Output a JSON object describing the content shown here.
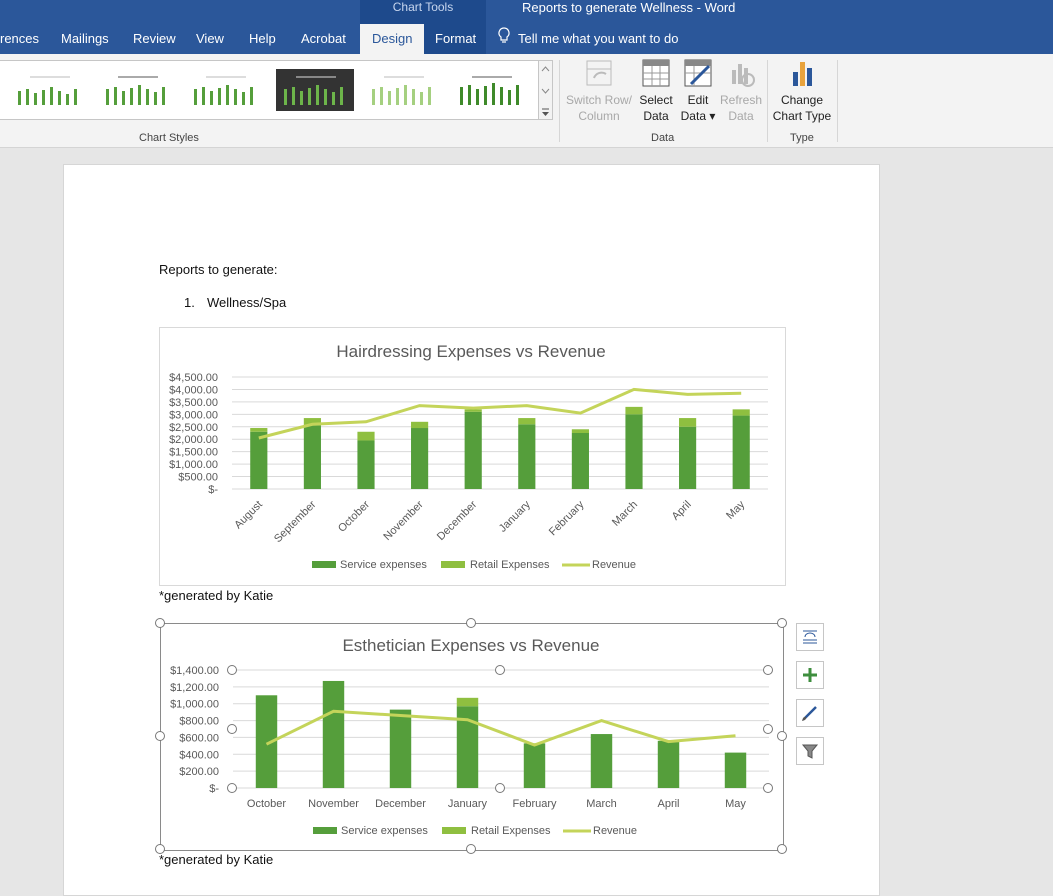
{
  "window": {
    "contextual_tab_group": "Chart Tools",
    "doc_title": "Reports to generate Wellness  -  Word"
  },
  "tabs": [
    "rences",
    "Mailings",
    "Review",
    "View",
    "Help",
    "Acrobat",
    "Design",
    "Format"
  ],
  "active_tab": "Design",
  "tellme": "Tell me what you want to do",
  "ribbon": {
    "chart_styles_label": "Chart Styles",
    "data_label": "Data",
    "type_label": "Type",
    "switch_row_1": "Switch Row/",
    "switch_row_2": "Column",
    "select_data_1": "Select",
    "select_data_2": "Data",
    "edit_data_1": "Edit",
    "edit_data_2": "Data ▾",
    "refresh_1": "Refresh",
    "refresh_2": "Data",
    "change_type_1": "Change",
    "change_type_2": "Chart Type"
  },
  "document": {
    "heading": "Reports to generate:",
    "list_num": "1.",
    "list_item": "Wellness/Spa",
    "caption1": "*generated by Katie",
    "caption2": "*generated by Katie"
  },
  "colors": {
    "service": "#559e3b",
    "retail": "#8fbf40",
    "revenue": "#c4d45a",
    "word_blue": "#2b579a"
  },
  "chart_data": [
    {
      "type": "bar",
      "title": "Hairdressing Expenses vs Revenue",
      "categories": [
        "August",
        "September",
        "October",
        "November",
        "December",
        "January",
        "February",
        "March",
        "April",
        "May"
      ],
      "series": [
        {
          "name": "Service expenses",
          "type": "bar",
          "values": [
            2300,
            2550,
            1950,
            2450,
            3100,
            2600,
            2250,
            3000,
            2500,
            2950
          ]
        },
        {
          "name": "Retail Expenses",
          "type": "bar",
          "values": [
            150,
            300,
            350,
            250,
            100,
            250,
            150,
            300,
            350,
            250
          ]
        },
        {
          "name": "Revenue",
          "type": "line",
          "values": [
            2050,
            2600,
            2700,
            3350,
            3250,
            3350,
            3050,
            4000,
            3800,
            3850
          ]
        }
      ],
      "yticks": [
        "$4,500.00",
        "$4,000.00",
        "$3,500.00",
        "$3,000.00",
        "$2,500.00",
        "$2,000.00",
        "$1,500.00",
        "$1,000.00",
        "$500.00",
        "$-"
      ],
      "ylim": [
        0,
        4500
      ]
    },
    {
      "type": "bar",
      "title": "Esthetician Expenses vs Revenue",
      "categories": [
        "October",
        "November",
        "December",
        "January",
        "February",
        "March",
        "April",
        "May"
      ],
      "series": [
        {
          "name": "Service expenses",
          "type": "bar",
          "values": [
            1100,
            1270,
            930,
            970,
            530,
            640,
            560,
            420
          ]
        },
        {
          "name": "Retail Expenses",
          "type": "bar",
          "values": [
            0,
            0,
            0,
            100,
            0,
            0,
            0,
            0
          ]
        },
        {
          "name": "Revenue",
          "type": "line",
          "values": [
            520,
            910,
            860,
            810,
            510,
            800,
            550,
            620
          ]
        }
      ],
      "yticks": [
        "$1,400.00",
        "$1,200.00",
        "$1,000.00",
        "$800.00",
        "$600.00",
        "$400.00",
        "$200.00",
        "$-"
      ],
      "ylim": [
        0,
        1400
      ]
    }
  ]
}
